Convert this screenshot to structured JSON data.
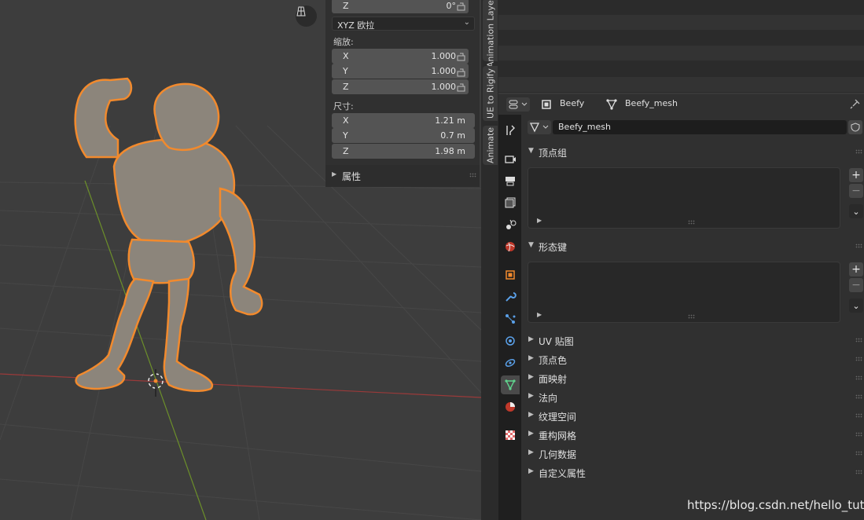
{
  "transform": {
    "rotation_z": {
      "axis": "Z",
      "value": "0°"
    },
    "rotation_mode": "XYZ 欧拉",
    "scale_label": "缩放:",
    "scale": [
      {
        "axis": "X",
        "value": "1.000"
      },
      {
        "axis": "Y",
        "value": "1.000"
      },
      {
        "axis": "Z",
        "value": "1.000"
      }
    ],
    "dimensions_label": "尺寸:",
    "dimensions": [
      {
        "axis": "X",
        "value": "1.21 m"
      },
      {
        "axis": "Y",
        "value": "0.7 m"
      },
      {
        "axis": "Z",
        "value": "1.98 m"
      }
    ],
    "properties_label": "属性"
  },
  "side_tabs": [
    "Animation Layers",
    "UE to Rigify",
    "Animate"
  ],
  "properties_header": {
    "object_name": "Beefy",
    "mesh_name": "Beefy_mesh"
  },
  "datablock": {
    "name": "Beefy_mesh"
  },
  "panels": {
    "vertex_groups": "顶点组",
    "shape_keys": "形态键",
    "uv_maps": "UV 贴图",
    "vertex_colors": "顶点色",
    "face_maps": "面映射",
    "normals": "法向",
    "texture_space": "纹理空间",
    "remesh": "重构网格",
    "geometry_data": "几何数据",
    "custom_properties": "自定义属性"
  },
  "property_tabs": [
    "tool-icon",
    "render-icon",
    "output-icon",
    "view-layer-icon",
    "scene-icon",
    "world-icon",
    "object-icon",
    "modifier-icon",
    "particles-icon",
    "physics-icon",
    "constraints-icon",
    "object-data-icon",
    "material-icon",
    "texture-icon"
  ],
  "colors": {
    "selection_outline": "#f28a2d",
    "active_tab": "#4a4a4a",
    "mesh_data_green": "#5fd38d"
  },
  "watermark": "https://blog.csdn.net/hello_tute"
}
